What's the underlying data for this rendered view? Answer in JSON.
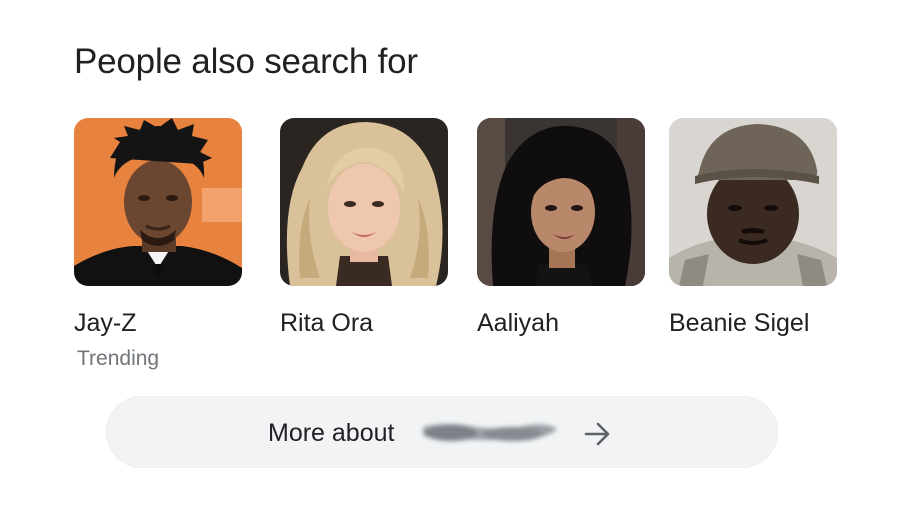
{
  "section": {
    "title": "People also search for"
  },
  "people": [
    {
      "name": "Jay-Z",
      "subtitle": "Trending",
      "icon": "person-photo",
      "photo_bg": "#e8823f"
    },
    {
      "name": "Rita Ora",
      "subtitle": "",
      "icon": "person-photo",
      "photo_bg": "#2b2522"
    },
    {
      "name": "Aaliyah",
      "subtitle": "",
      "icon": "person-photo",
      "photo_bg": "#3a3433"
    },
    {
      "name": "Beanie Sigel",
      "subtitle": "",
      "icon": "person-photo",
      "photo_bg": "#d9d6d2"
    }
  ],
  "more_button": {
    "label": "More about",
    "redacted": true,
    "icon": "arrow-right-icon"
  },
  "colors": {
    "text_primary": "#202124",
    "text_secondary": "#70757a",
    "button_bg": "#f1f3f4"
  }
}
